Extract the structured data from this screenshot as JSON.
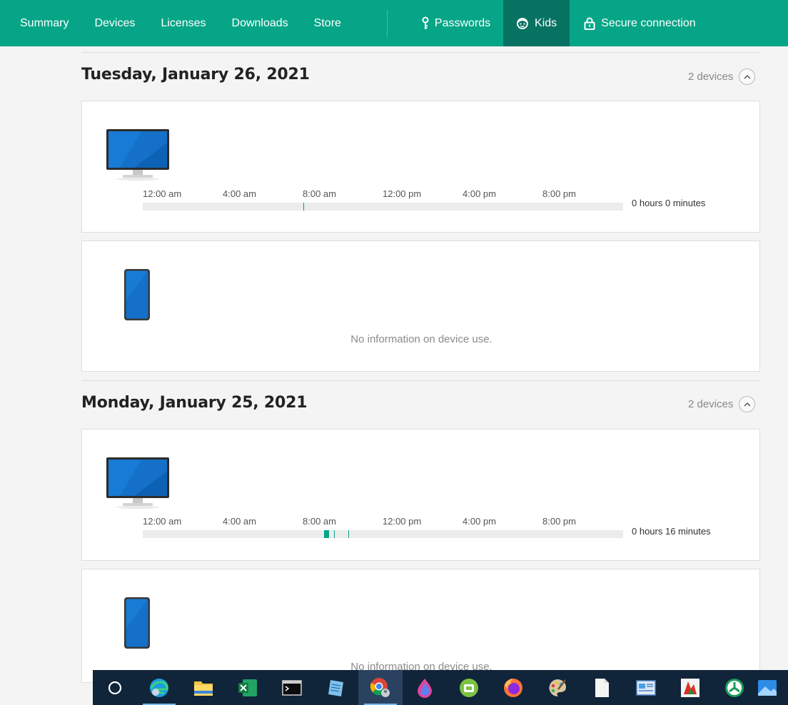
{
  "nav": {
    "items": [
      "Summary",
      "Devices",
      "Licenses",
      "Downloads",
      "Store"
    ],
    "passwords": "Passwords",
    "kids": "Kids",
    "secure": "Secure connection"
  },
  "colors": {
    "accent": "#07a587",
    "active": "#077262"
  },
  "days": [
    {
      "title": "Tuesday, January 26, 2021",
      "count": "2 devices",
      "computer": {
        "ticks": [
          "12:00 am",
          "4:00 am",
          "8:00 am",
          "12:00 pm",
          "4:00 pm",
          "8:00 pm"
        ],
        "total": "0 hours 0 minutes"
      },
      "phone": {
        "noinfo": "No information on device use."
      }
    },
    {
      "title": "Monday, January 25, 2021",
      "count": "2 devices",
      "computer": {
        "ticks": [
          "12:00 am",
          "4:00 am",
          "8:00 am",
          "12:00 pm",
          "4:00 pm",
          "8:00 pm"
        ],
        "total": "0 hours 16 minutes"
      },
      "phone": {
        "noinfo": "No information on device use."
      }
    }
  ],
  "taskbar": {
    "icons": [
      "cortana-icon",
      "edge-icon",
      "file-explorer-icon",
      "excel-icon",
      "terminal-icon",
      "notepad-icon",
      "chrome-icon",
      "paint-drop-icon",
      "android-icon",
      "firefox-icon",
      "paint-palette-icon",
      "blank-document-icon",
      "control-panel-icon",
      "mail-icon",
      "recycle-icon",
      "photos-icon"
    ]
  }
}
